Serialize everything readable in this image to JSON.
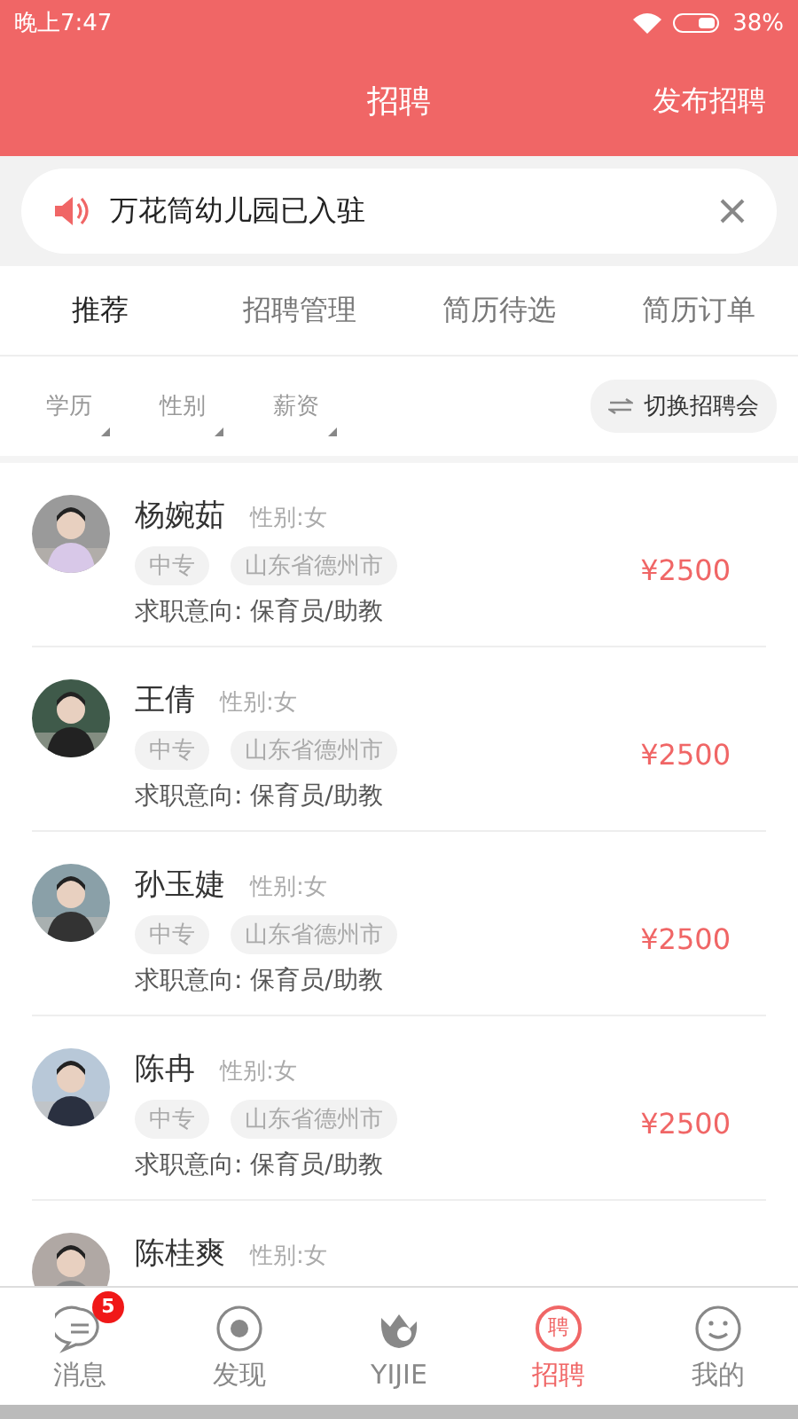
{
  "status_bar": {
    "time": "晚上7:47",
    "battery": "38%"
  },
  "header": {
    "title": "招聘",
    "action": "发布招聘"
  },
  "notice": {
    "text": "万花筒幼儿园已入驻"
  },
  "tabs": [
    {
      "label": "推荐",
      "selected": true
    },
    {
      "label": "招聘管理",
      "selected": false
    },
    {
      "label": "简历待选",
      "selected": false
    },
    {
      "label": "简历订单",
      "selected": false
    }
  ],
  "filters": [
    "学历",
    "性别",
    "薪资"
  ],
  "switch_button": "切换招聘会",
  "candidates": [
    {
      "name": "杨婉茹",
      "gender": "性别:女",
      "tags": [
        "中专",
        "山东省德州市"
      ],
      "intent": "求职意向: 保育员/助教",
      "salary": "¥2500"
    },
    {
      "name": "王倩",
      "gender": "性别:女",
      "tags": [
        "中专",
        "山东省德州市"
      ],
      "intent": "求职意向: 保育员/助教",
      "salary": "¥2500"
    },
    {
      "name": "孙玉婕",
      "gender": "性别:女",
      "tags": [
        "中专",
        "山东省德州市"
      ],
      "intent": "求职意向: 保育员/助教",
      "salary": "¥2500"
    },
    {
      "name": "陈冉",
      "gender": "性别:女",
      "tags": [
        "中专",
        "山东省德州市"
      ],
      "intent": "求职意向: 保育员/助教",
      "salary": "¥2500"
    },
    {
      "name": "陈桂爽",
      "gender": "性别:女"
    }
  ],
  "bottom_nav": [
    {
      "label": "消息",
      "badge": "5",
      "selected": false
    },
    {
      "label": "发现",
      "selected": false
    },
    {
      "label": "YIJIE",
      "selected": false
    },
    {
      "label": "招聘",
      "icon_text": "聘",
      "selected": true
    },
    {
      "label": "我的",
      "selected": false
    }
  ]
}
